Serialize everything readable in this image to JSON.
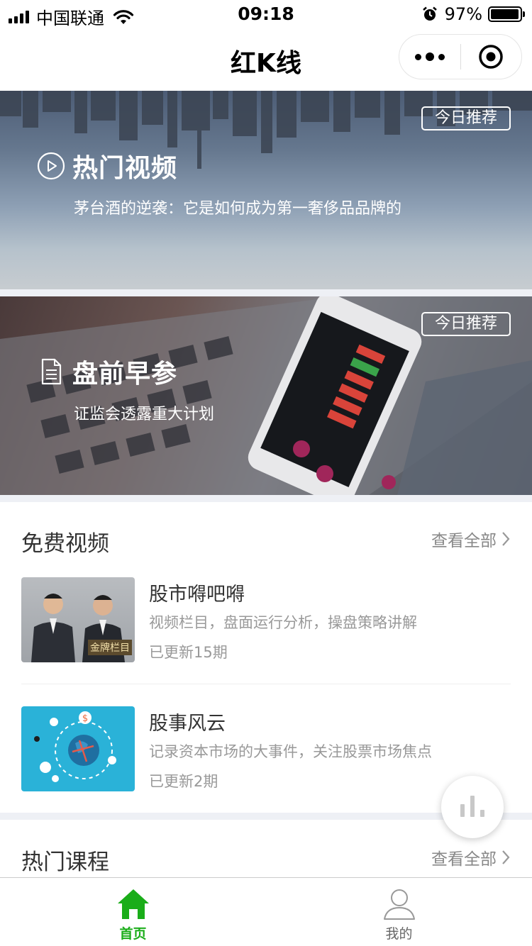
{
  "status_bar": {
    "carrier": "中国联通",
    "time": "09:18",
    "battery": "97%",
    "battery_level": 0.97
  },
  "nav": {
    "title": "红K线",
    "more_icon": "more-dots-icon",
    "close_icon": "target-close-icon"
  },
  "banners": [
    {
      "tag": "今日推荐",
      "title": "热门视频",
      "icon": "play-circle-icon",
      "description": "茅台酒的逆袭：它是如何成为第一奢侈品品牌的"
    },
    {
      "tag": "今日推荐",
      "title": "盘前早参",
      "icon": "document-icon",
      "description": "证监会透露重大计划"
    }
  ],
  "free_videos": {
    "title": "免费视频",
    "view_all": "查看全部",
    "items": [
      {
        "title": "股市嘚吧嘚",
        "description": "视频栏目，盘面运行分析，操盘策略讲解",
        "meta": "已更新15期",
        "badge": "金牌栏目"
      },
      {
        "title": "股事风云",
        "description": "记录资本市场的大事件，关注股票市场焦点",
        "meta": "已更新2期"
      }
    ]
  },
  "hot_courses": {
    "title": "热门课程",
    "view_all": "查看全部"
  },
  "tab_bar": {
    "items": [
      {
        "label": "首页",
        "icon": "home-icon",
        "active": true
      },
      {
        "label": "我的",
        "icon": "user-icon",
        "active": false
      }
    ]
  },
  "colors": {
    "accent": "#1aad19",
    "separator": "#eef0f5"
  }
}
